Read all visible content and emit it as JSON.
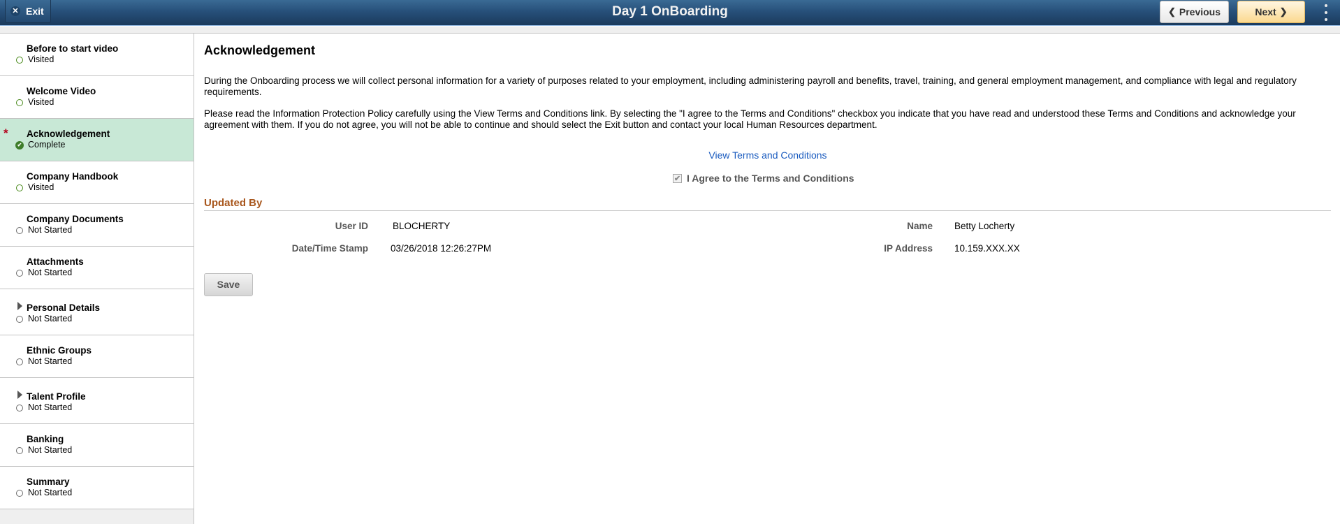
{
  "header": {
    "title": "Day 1 OnBoarding",
    "exit_label": "Exit",
    "previous_label": "Previous",
    "next_label": "Next",
    "colors": {
      "bar": "#27507a",
      "next_button": "#fbd98f"
    }
  },
  "sidebar": {
    "items": [
      {
        "title": "Before to start video",
        "status": "Visited",
        "status_type": "visited",
        "expandable": false,
        "required": false,
        "selected": false
      },
      {
        "title": "Welcome Video",
        "status": "Visited",
        "status_type": "visited",
        "expandable": false,
        "required": false,
        "selected": false
      },
      {
        "title": "Acknowledgement",
        "status": "Complete",
        "status_type": "complete",
        "expandable": false,
        "required": true,
        "selected": true
      },
      {
        "title": "Company Handbook",
        "status": "Visited",
        "status_type": "visited",
        "expandable": false,
        "required": false,
        "selected": false
      },
      {
        "title": "Company Documents",
        "status": "Not Started",
        "status_type": "not-started",
        "expandable": false,
        "required": false,
        "selected": false
      },
      {
        "title": "Attachments",
        "status": "Not Started",
        "status_type": "not-started",
        "expandable": false,
        "required": false,
        "selected": false
      },
      {
        "title": "Personal Details",
        "status": "Not Started",
        "status_type": "not-started",
        "expandable": true,
        "required": false,
        "selected": false
      },
      {
        "title": "Ethnic Groups",
        "status": "Not Started",
        "status_type": "not-started",
        "expandable": false,
        "required": false,
        "selected": false
      },
      {
        "title": "Talent Profile",
        "status": "Not Started",
        "status_type": "not-started",
        "expandable": true,
        "required": false,
        "selected": false
      },
      {
        "title": "Banking",
        "status": "Not Started",
        "status_type": "not-started",
        "expandable": false,
        "required": false,
        "selected": false
      },
      {
        "title": "Summary",
        "status": "Not Started",
        "status_type": "not-started",
        "expandable": false,
        "required": false,
        "selected": false
      }
    ],
    "selected_color": "#c8e8d6"
  },
  "main": {
    "title": "Acknowledgement",
    "paragraphs": [
      "During the Onboarding process we will collect personal information for a variety of purposes related to your employment, including administering payroll and benefits, travel, training, and general employment management, and compliance with legal and regulatory requirements.",
      "Please read the Information Protection Policy carefully using the View Terms and Conditions link. By selecting the \"I agree to the Terms and Conditions\" checkbox you indicate that you have read and understood these Terms and Conditions and acknowledge your agreement with them. If you do not agree, you will not be able to continue and should select the Exit button and contact your local Human Resources department."
    ],
    "terms_link": "View Terms and Conditions",
    "agree_label": "I Agree to the Terms and Conditions",
    "agree_checked": true,
    "updated_by": {
      "section_title": "Updated By",
      "user_id_label": "User ID",
      "user_id": "BLOCHERTY",
      "name_label": "Name",
      "name": "Betty Locherty",
      "timestamp_label": "Date/Time Stamp",
      "timestamp": "03/26/2018 12:26:27PM",
      "ip_label": "IP Address",
      "ip": "10.159.XXX.XX"
    },
    "save_label": "Save",
    "link_color": "#1a5bbf",
    "section_color": "#a8561c"
  }
}
